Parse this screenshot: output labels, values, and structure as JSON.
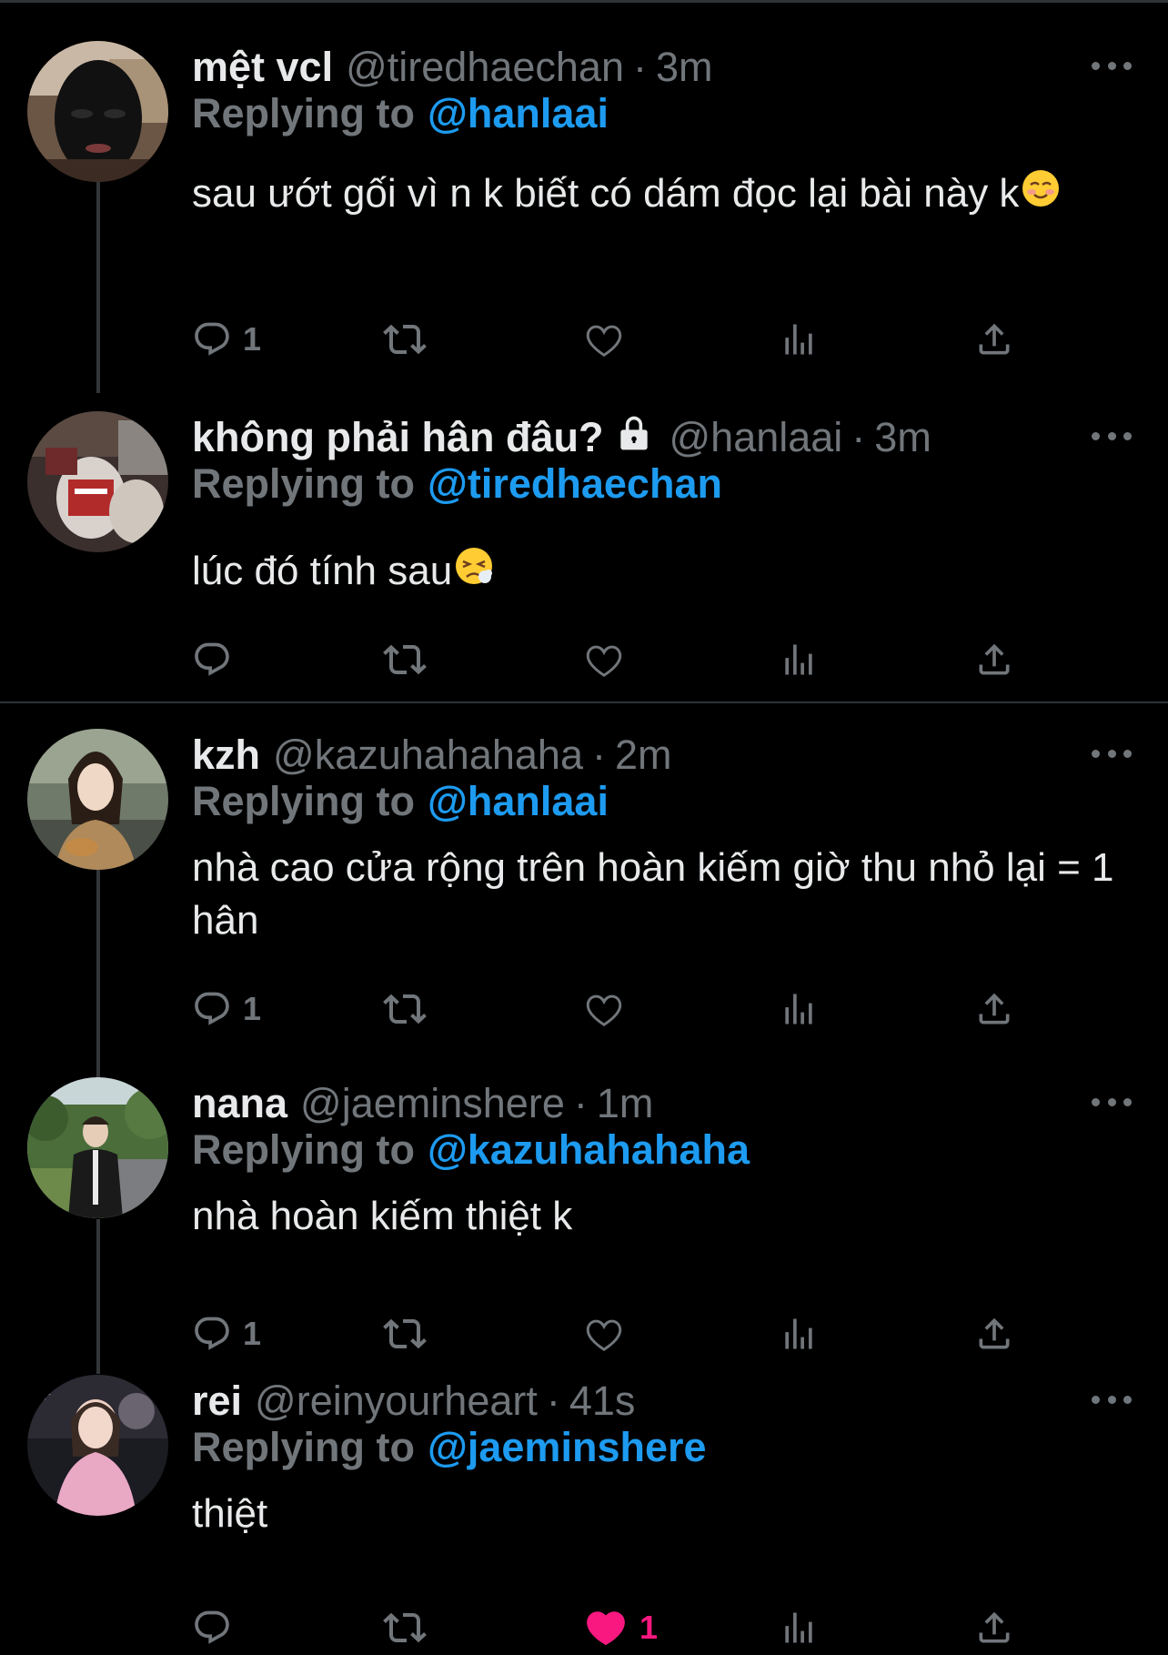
{
  "tweets": [
    {
      "name": "mệt vcl",
      "handle": "@tiredhaechan",
      "time": "3m",
      "replying_label": "Replying to",
      "replying_to": "@hanlaai",
      "text": "sau ướt gối vì n k biết có dám đọc lại bài này k",
      "emoji": "smiling-blush-emoji",
      "actions": {
        "reply_count": "1",
        "retweet_count": "",
        "like_count": "",
        "liked": false
      },
      "avatar": "black-face-mask-avatar"
    },
    {
      "name": "không phải hân đâu?",
      "protected": true,
      "handle": "@hanlaai",
      "time": "3m",
      "replying_label": "Replying to",
      "replying_to": "@tiredhaechan",
      "text": "lúc đó tính sau",
      "emoji": "tired-face-emoji",
      "actions": {
        "reply_count": "",
        "retweet_count": "",
        "like_count": "",
        "liked": false
      },
      "avatar": "photo-avatar"
    },
    {
      "name": "kzh",
      "handle": "@kazuhahahaha",
      "time": "2m",
      "replying_label": "Replying to",
      "replying_to": "@hanlaai",
      "text": "nhà cao cửa rộng trên hoàn kiếm giờ thu nhỏ lại = 1 hân",
      "actions": {
        "reply_count": "1",
        "retweet_count": "",
        "like_count": "",
        "liked": false
      },
      "avatar": "girl-photo-avatar"
    },
    {
      "name": "nana",
      "handle": "@jaeminshere",
      "time": "1m",
      "replying_label": "Replying to",
      "replying_to": "@kazuhahahaha",
      "text": "nhà hoàn kiếm thiệt k",
      "actions": {
        "reply_count": "1",
        "retweet_count": "",
        "like_count": "",
        "liked": false
      },
      "avatar": "man-outdoor-avatar"
    },
    {
      "name": "rei",
      "handle": "@reinyourheart",
      "time": "41s",
      "replying_label": "Replying to",
      "replying_to": "@jaeminshere",
      "text": "thiệt",
      "actions": {
        "reply_count": "",
        "retweet_count": "",
        "like_count": "1",
        "liked": true
      },
      "avatar": "pink-outfit-avatar"
    }
  ],
  "colors": {
    "background": "#000000",
    "text": "#e7e9ea",
    "secondary": "#71767b",
    "link": "#1d9bf0",
    "like": "#f91880",
    "divider": "#2f3336"
  }
}
